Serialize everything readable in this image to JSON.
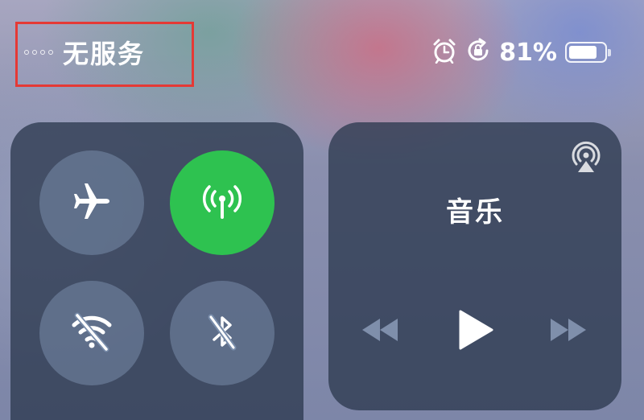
{
  "status_bar": {
    "carrier": "无服务",
    "battery_percent": "81%",
    "battery_level": 0.81,
    "icons": [
      "alarm-icon",
      "rotation-lock-icon"
    ]
  },
  "connectivity": {
    "airplane": {
      "icon": "airplane-icon",
      "on": false
    },
    "cellular": {
      "icon": "cellular-antenna-icon",
      "on": true,
      "color": "#2ec250"
    },
    "wifi": {
      "icon": "wifi-off-icon",
      "on": false
    },
    "bluetooth": {
      "icon": "bluetooth-off-icon",
      "on": false
    }
  },
  "music": {
    "title": "音乐",
    "icons": [
      "airplay-icon",
      "rewind-icon",
      "play-icon",
      "fast-forward-icon"
    ]
  },
  "colors": {
    "highlight_box": "#e53935",
    "active_green": "#2ec250"
  }
}
